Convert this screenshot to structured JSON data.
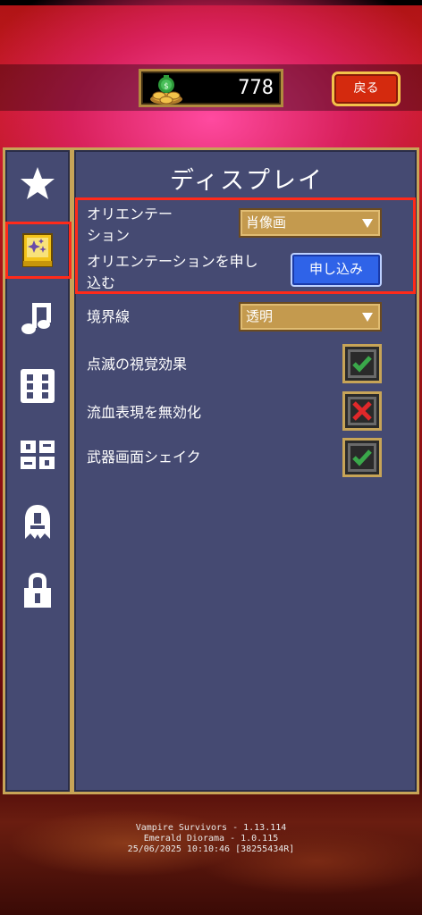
{
  "header": {
    "coin_count": "778",
    "back_label": "戻る"
  },
  "sidebar": {
    "items": [
      {
        "icon": "star-icon"
      },
      {
        "icon": "spellbook-icon",
        "selected": true
      },
      {
        "icon": "music-note-icon"
      },
      {
        "icon": "dice-icon"
      },
      {
        "icon": "controller-icon"
      },
      {
        "icon": "ghost-icon"
      },
      {
        "icon": "lock-icon"
      }
    ]
  },
  "main": {
    "title": "ディスプレイ",
    "orientation": {
      "label_line1": "オリエンテー",
      "label_line2": "ション",
      "value": "肖像画"
    },
    "apply_orientation": {
      "label_line1": "オリエンテーションを申し",
      "label_line2": "込む",
      "button_label": "申し込み"
    },
    "border": {
      "label": "境界線",
      "value": "透明"
    },
    "flash_effects": {
      "label": "点滅の視覚効果",
      "checked": true
    },
    "disable_blood": {
      "label": "流血表現を無効化",
      "checked": false
    },
    "weapon_shake": {
      "label": "武器画面シェイク",
      "checked": true
    }
  },
  "footer": {
    "version_line1": "Vampire Survivors - 1.13.114",
    "version_line2": "Emerald Diorama - 1.0.115",
    "version_line3": "25/06/2025 10:10:46 [38255434R]"
  },
  "colors": {
    "panel": "#454a72",
    "gold_border": "#c7a457",
    "highlight": "#ff2a1a",
    "apply_button": "#2f63e8",
    "check_green": "#3aa84a",
    "cross_red": "#e0282a"
  }
}
